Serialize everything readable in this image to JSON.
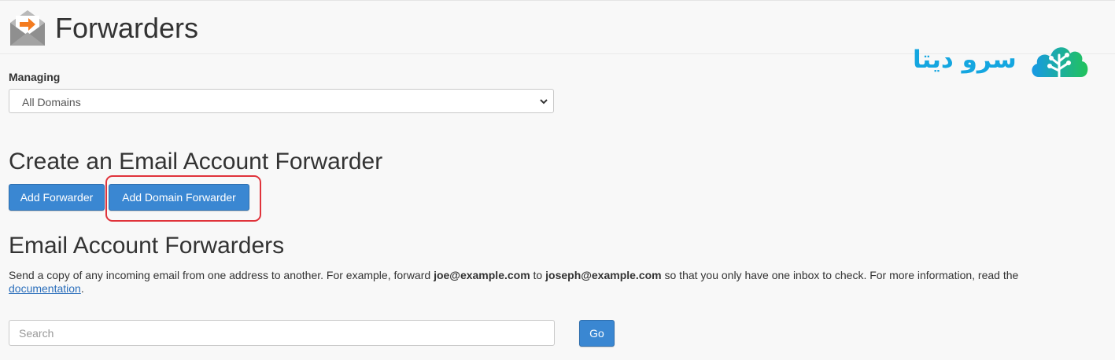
{
  "header": {
    "title": "Forwarders",
    "icon": "envelope-forward-icon"
  },
  "logo": {
    "text": "سرو دیتا",
    "icon": "cloud-tree-icon",
    "color": "#14a6e0"
  },
  "managing": {
    "label": "Managing",
    "selected": "All Domains"
  },
  "create_section": {
    "heading": "Create an Email Account Forwarder",
    "add_forwarder_label": "Add Forwarder",
    "add_domain_forwarder_label": "Add Domain Forwarder",
    "highlight_color": "#e0333b"
  },
  "forwarders_section": {
    "heading": "Email Account Forwarders",
    "desc_part1": "Send a copy of any incoming email from one address to another. For example, forward ",
    "desc_email1": "joe@example.com",
    "desc_part2": " to ",
    "desc_email2": "joseph@example.com",
    "desc_part3": " so that you only have one inbox to check. For more information, read the ",
    "desc_link": "documentation",
    "desc_end": "."
  },
  "search": {
    "placeholder": "Search",
    "go_label": "Go"
  },
  "colors": {
    "button": "#3a87d2",
    "link": "#2a6ebb",
    "icon_orange": "#f47c20"
  }
}
